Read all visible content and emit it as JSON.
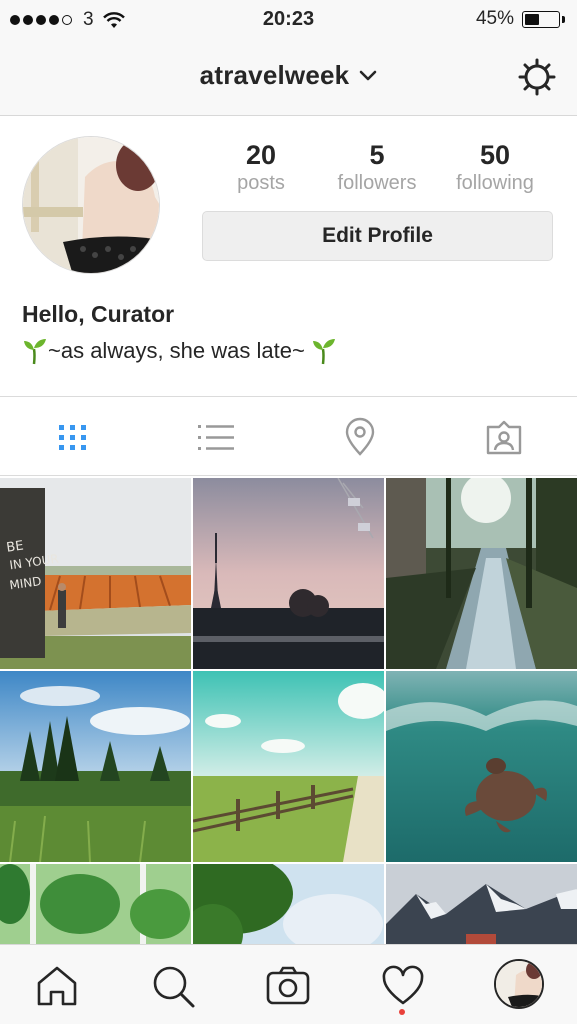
{
  "status_bar": {
    "carrier": "3",
    "time": "20:23",
    "battery_percent_label": "45%",
    "battery_level": 0.45,
    "signal_bars_filled": 4,
    "signal_bars_total": 5
  },
  "nav": {
    "username": "atravelweek",
    "chevron_icon": "chevron-down-icon",
    "settings_icon": "gear-icon"
  },
  "profile": {
    "stats": [
      {
        "value": "20",
        "label": "posts"
      },
      {
        "value": "5",
        "label": "followers"
      },
      {
        "value": "50",
        "label": "following"
      }
    ],
    "edit_profile_label": "Edit Profile",
    "bio_name": "Hello, Curator",
    "bio_text": "~as always, she was late~",
    "bio_emoji": "seedling"
  },
  "tabs": [
    {
      "name": "grid-view",
      "icon": "grid-icon",
      "active": true
    },
    {
      "name": "list-view",
      "icon": "list-icon",
      "active": false
    },
    {
      "name": "location",
      "icon": "location-pin-icon",
      "active": false
    },
    {
      "name": "tagged",
      "icon": "tagged-photos-icon",
      "active": false
    }
  ],
  "grid_posts": [
    {
      "subject": "tulip-field-graffiti"
    },
    {
      "subject": "eiffel-tower-dusk"
    },
    {
      "subject": "canal-trees"
    },
    {
      "subject": "pine-forest-sky"
    },
    {
      "subject": "field-fence-road"
    },
    {
      "subject": "underwater-turtle"
    },
    {
      "subject": "palm-window"
    },
    {
      "subject": "tree-sky"
    },
    {
      "subject": "snowy-mountains"
    }
  ],
  "bottom_tabs": [
    {
      "name": "home",
      "icon": "home-icon"
    },
    {
      "name": "search",
      "icon": "search-icon"
    },
    {
      "name": "camera",
      "icon": "camera-icon"
    },
    {
      "name": "activity",
      "icon": "heart-icon",
      "has_notification": true
    },
    {
      "name": "profile",
      "icon": "avatar"
    }
  ],
  "colors": {
    "active_tab": "#3897f0",
    "inactive_icon": "#999999",
    "notification": "#e9413a"
  }
}
